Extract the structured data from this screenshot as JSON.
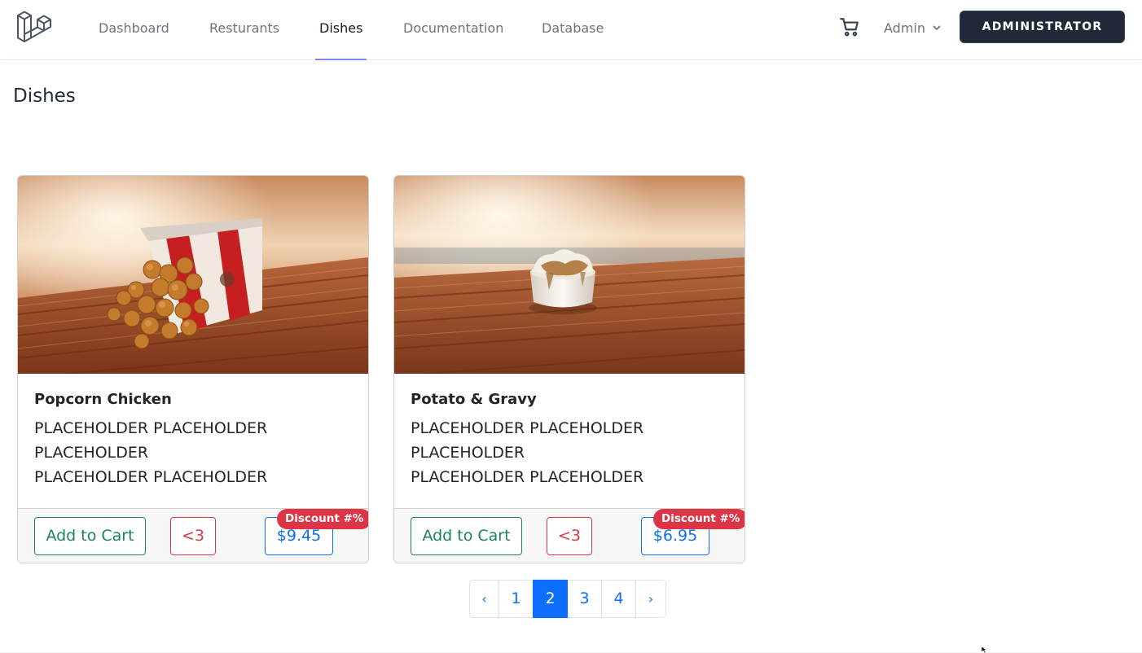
{
  "nav": {
    "links": [
      {
        "label": "Dashboard",
        "active": false
      },
      {
        "label": "Resturants",
        "active": false
      },
      {
        "label": "Dishes",
        "active": true
      },
      {
        "label": "Documentation",
        "active": false
      },
      {
        "label": "Database",
        "active": false
      }
    ],
    "user_label": "Admin",
    "role_button": "ADMINISTRATOR",
    "icons": {
      "logo": "laravel-logo",
      "cart": "shopping-cart-icon",
      "dropdown": "chevron-down-icon"
    }
  },
  "header": {
    "title": "Dishes"
  },
  "dishes": [
    {
      "name": "Popcorn Chicken",
      "description": [
        "PLACEHOLDER PLACEHOLDER",
        "PLACEHOLDER",
        "PLACEHOLDER PLACEHOLDER"
      ],
      "add_to_cart": "Add to Cart",
      "favorite": "<3",
      "price": "$9.45",
      "badge": "Discount #%"
    },
    {
      "name": "Potato & Gravy",
      "description": [
        "PLACEHOLDER PLACEHOLDER",
        "PLACEHOLDER",
        "PLACEHOLDER PLACEHOLDER"
      ],
      "add_to_cart": "Add to Cart",
      "favorite": "<3",
      "price": "$6.95",
      "badge": "Discount #%"
    }
  ],
  "pagination": {
    "prev": "‹",
    "pages": [
      "1",
      "2",
      "3",
      "4"
    ],
    "current": "2",
    "next": "›"
  },
  "colors": {
    "accent": "#0d6efd",
    "success": "#198754",
    "danger": "#dc3545",
    "dark": "#1f2937",
    "nav_underline": "#818cf8"
  }
}
